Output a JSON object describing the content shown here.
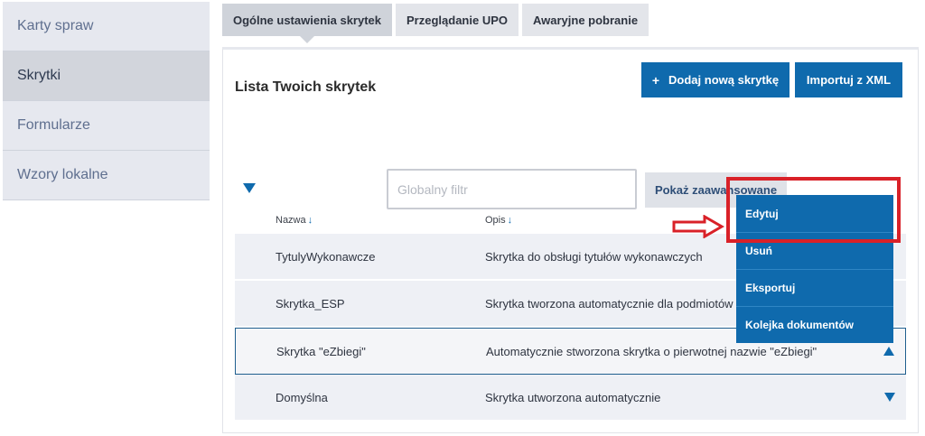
{
  "sidebar": {
    "items": [
      {
        "label": "Karty spraw"
      },
      {
        "label": "Skrytki"
      },
      {
        "label": "Formularze"
      },
      {
        "label": "Wzory lokalne"
      }
    ]
  },
  "tabs": [
    {
      "label": "Ogólne ustawienia skrytek"
    },
    {
      "label": "Przeglądanie UPO"
    },
    {
      "label": "Awaryjne pobranie"
    }
  ],
  "panel": {
    "title": "Lista Twoich skrytek",
    "add_button_label": "Dodaj nową skrytkę",
    "add_button_icon": "+",
    "import_button_label": "Importuj z XML",
    "filter_placeholder": "Globalny filtr",
    "advanced_button_label": "Pokaż zaawansowane",
    "columns": {
      "name": "Nazwa",
      "desc": "Opis",
      "sort_icon": "↓"
    }
  },
  "rows": [
    {
      "name": "TytulyWykonawcze",
      "desc": "Skrytka do obsługi tytułów wykonawczych"
    },
    {
      "name": "Skrytka_ESP",
      "desc": "Skrytka tworzona automatycznie dla podmiotów publicznych"
    },
    {
      "name": "Skrytka \"eZbiegi\"",
      "desc": "Automatycznie stworzona skrytka o pierwotnej nazwie \"eZbiegi\""
    },
    {
      "name": "Domyślna",
      "desc": "Skrytka utworzona automatycznie"
    }
  ],
  "menu": {
    "items": [
      {
        "label": "Edytuj"
      },
      {
        "label": "Usuń"
      },
      {
        "label": "Eksportuj"
      },
      {
        "label": "Kolejka dokumentów"
      }
    ]
  },
  "colors": {
    "accent": "#0f6aad",
    "annotation": "#d92128"
  }
}
